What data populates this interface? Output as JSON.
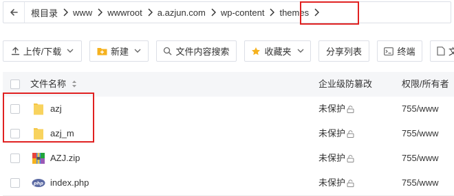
{
  "breadcrumb": {
    "items": [
      "根目录",
      "www",
      "wwwroot",
      "a.azjun.com",
      "wp-content",
      "themes"
    ]
  },
  "toolbar": {
    "upload_download": "上传/下载",
    "new": "新建",
    "content_search": "文件内容搜索",
    "favorites": "收藏夹",
    "share_list": "分享列表",
    "terminal": "终端",
    "partial": "文"
  },
  "table": {
    "columns": {
      "name": "文件名称",
      "protection": "企业级防篡改",
      "permission": "权限/所有者"
    },
    "rows": [
      {
        "name": "azj",
        "type": "folder",
        "protection": "未保护",
        "permission": "755/www"
      },
      {
        "name": "azj_m",
        "type": "folder",
        "protection": "未保护",
        "permission": "755/www"
      },
      {
        "name": "AZJ.zip",
        "type": "zip",
        "protection": "未保护",
        "permission": "755/www"
      },
      {
        "name": "index.php",
        "type": "php",
        "protection": "未保护",
        "permission": "755/www"
      }
    ]
  },
  "colors": {
    "highlight": "#e02020",
    "folder": "#f5c542",
    "accent": "#20a53a"
  }
}
